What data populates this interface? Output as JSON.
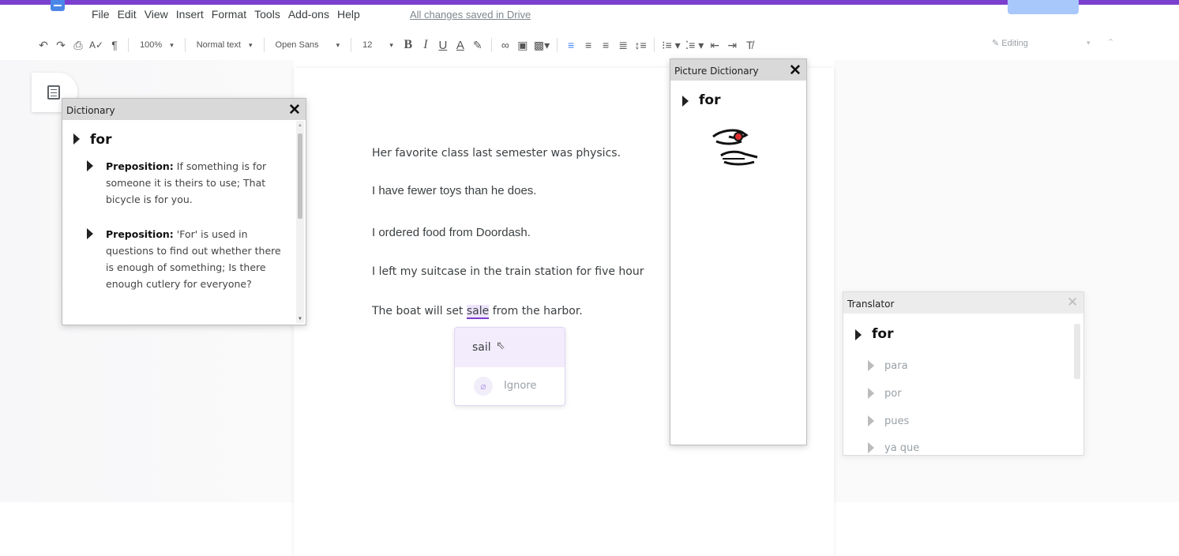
{
  "menu": {
    "items": [
      "File",
      "Edit",
      "View",
      "Insert",
      "Format",
      "Tools",
      "Add-ons",
      "Help"
    ],
    "saved_status": "All changes saved in Drive"
  },
  "toolbar": {
    "zoom": "100%",
    "style": "Normal text",
    "font": "Open Sans",
    "size": "12",
    "bold": "B",
    "italic": "I",
    "underline": "U",
    "text_color": "A",
    "mode": "Editing"
  },
  "document": {
    "lines": [
      "Her favorite class last semester was physics.",
      "I have fewer toys than he does.",
      "I ordered food from Doordash.",
      "I left my suitcase in the train station for five hour"
    ],
    "last_line_before": "The boat will set ",
    "misspelled_word": "sale",
    "last_line_after": " from the harbor."
  },
  "spellcheck": {
    "suggestion": "sail",
    "ignore_label": "Ignore"
  },
  "dictionary": {
    "title": "Dictionary",
    "word": "for",
    "definitions": [
      {
        "pos": "Preposition:",
        "text": " If something is for someone it is theirs to use; That bicycle is for you."
      },
      {
        "pos": "Preposition:",
        "text": " 'For' is used in questions to find out whether there is enough of something; Is there enough cutlery for everyone?"
      }
    ]
  },
  "picture_dictionary": {
    "title": "Picture Dictionary",
    "word": "for"
  },
  "translator": {
    "title": "Translator",
    "word": "for",
    "translations": [
      "para",
      "por",
      "pues",
      "ya que"
    ]
  },
  "colors": {
    "accent": "#7b3fd0",
    "docs_blue": "#4a86e8"
  }
}
